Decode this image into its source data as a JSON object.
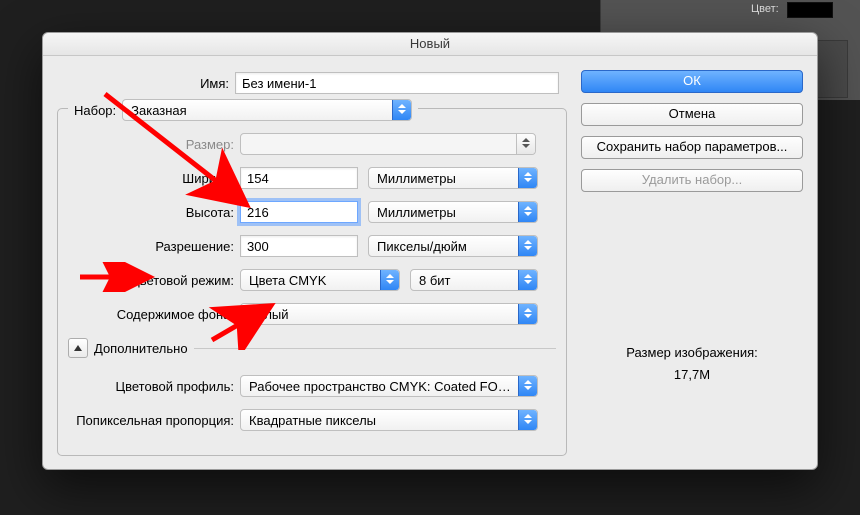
{
  "dialog": {
    "title": "Новый"
  },
  "labels": {
    "name": "Имя:",
    "preset": "Набор:",
    "size": "Размер:",
    "width": "Ширина:",
    "height": "Высота:",
    "resolution": "Разрешение:",
    "color_mode": "Цветовой режим:",
    "background": "Содержимое фона:",
    "advanced": "Дополнительно",
    "color_profile": "Цветовой профиль:",
    "pixel_aspect": "Попиксельная пропорция:"
  },
  "values": {
    "name": "Без имени-1",
    "preset": "Заказная",
    "size": "",
    "width": "154",
    "width_unit": "Миллиметры",
    "height": "216",
    "height_unit": "Миллиметры",
    "resolution": "300",
    "resolution_unit": "Пикселы/дюйм",
    "color_mode": "Цвета CMYK",
    "bit_depth": "8 бит",
    "background": "Белый",
    "color_profile": "Рабочее пространство CMYK:  Coated FOG...",
    "pixel_aspect": "Квадратные пикселы"
  },
  "buttons": {
    "ok": "ОК",
    "cancel": "Отмена",
    "save_preset": "Сохранить набор параметров...",
    "delete_preset": "Удалить набор..."
  },
  "info": {
    "image_size_label": "Размер изображения:",
    "image_size_value": "17,7M"
  },
  "ps_panel": {
    "color_label": "Цвет:"
  }
}
